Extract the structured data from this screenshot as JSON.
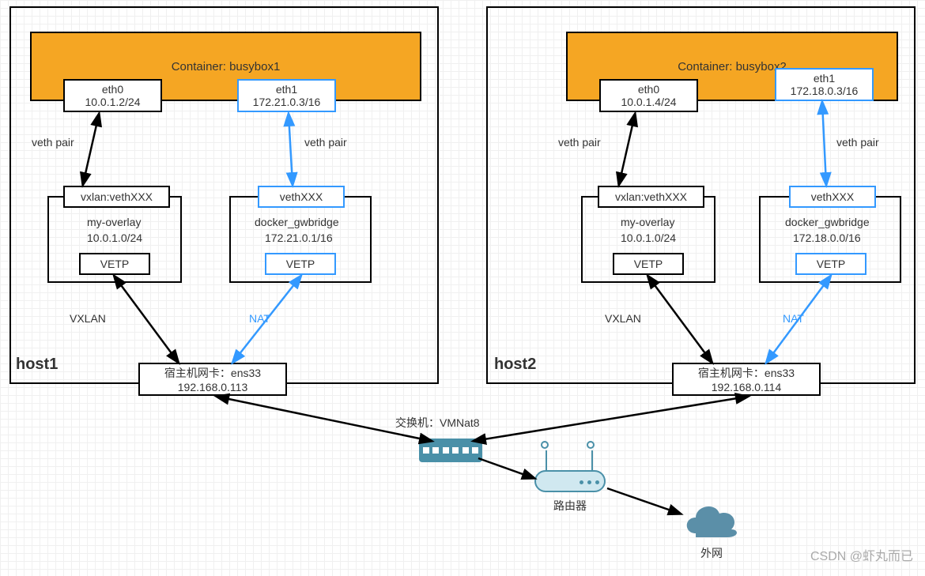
{
  "host1": {
    "label": "host1",
    "container": {
      "title": "Container: busybox1"
    },
    "eth0": {
      "name": "eth0",
      "ip": "10.0.1.2/24"
    },
    "eth1": {
      "name": "eth1",
      "ip": "172.21.0.3/16"
    },
    "vethpair_left": "veth pair",
    "vethpair_right": "veth pair",
    "vxlan_veth": "vxlan:vethXXX",
    "vethxxx": "vethXXX",
    "overlay": {
      "name": "my-overlay",
      "ip": "10.0.1.0/24"
    },
    "gwbridge": {
      "name": "docker_gwbridge",
      "ip": "172.21.0.1/16"
    },
    "vetp_left": "VETP",
    "vetp_right": "VETP",
    "vxlan_label": "VXLAN",
    "nat_label": "NAT",
    "nic": {
      "name": "宿主机网卡：ens33",
      "ip": "192.168.0.113"
    }
  },
  "host2": {
    "label": "host2",
    "container": {
      "title": "Container: busybox2"
    },
    "eth0": {
      "name": "eth0",
      "ip": "10.0.1.4/24"
    },
    "eth1": {
      "name": "eth1",
      "ip": "172.18.0.3/16"
    },
    "vethpair_left": "veth pair",
    "vethpair_right": "veth pair",
    "vxlan_veth": "vxlan:vethXXX",
    "vethxxx": "vethXXX",
    "overlay": {
      "name": "my-overlay",
      "ip": "10.0.1.0/24"
    },
    "gwbridge": {
      "name": "docker_gwbridge",
      "ip": "172.18.0.0/16"
    },
    "vetp_left": "VETP",
    "vetp_right": "VETP",
    "vxlan_label": "VXLAN",
    "nat_label": "NAT",
    "nic": {
      "name": "宿主机网卡：ens33",
      "ip": "192.168.0.114"
    }
  },
  "switch": {
    "label": "交换机：VMNat8"
  },
  "router": {
    "label": "路由器"
  },
  "internet": {
    "label": "外网"
  },
  "watermark": "CSDN @虾丸而已"
}
